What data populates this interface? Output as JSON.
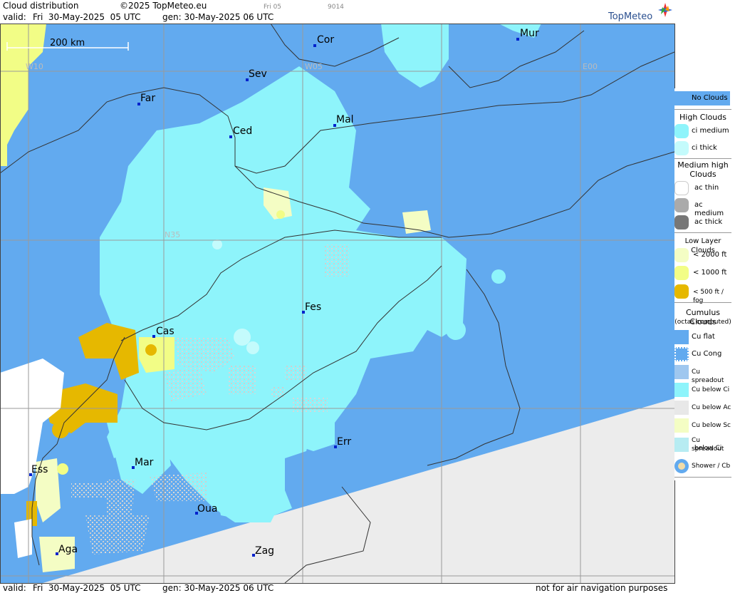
{
  "header": {
    "title": "Cloud distribution",
    "copyright": "©2025 TopMeteo.eu",
    "valid_label": "valid:",
    "valid_value": "Fri  30-May-2025  05 UTC",
    "gen_value": "gen: 30-May-2025 06 UTC",
    "small_code_1": "Fri 05",
    "small_code_2": "9014",
    "logo_text": "TopMeteo"
  },
  "map": {
    "scale_label": "200 km",
    "grid_labels": [
      "W10",
      "W05",
      "E00",
      "N35"
    ],
    "cities": [
      "Cor",
      "Mur",
      "Sev",
      "Far",
      "Mal",
      "Ced",
      "Fes",
      "Cas",
      "Err",
      "Mar",
      "Ess",
      "Oua",
      "Aga",
      "Zag"
    ]
  },
  "legend": {
    "no_clouds": "No Clouds",
    "high_clouds": "High Clouds",
    "ci_medium": "ci medium",
    "ci_thick": "ci thick",
    "medium_high_clouds_1": "Medium high",
    "medium_high_clouds_2": "Clouds",
    "ac_thin": "ac thin",
    "ac_medium": "ac medium",
    "ac_thick": "ac thick",
    "low_layer_clouds": "Low Layer Clouds",
    "lt2000": "< 2000 ft",
    "lt1000": "< 1000 ft",
    "lt500": "< 500 ft / fog",
    "cumulus_clouds": "Cumulus Clouds",
    "octas_computed": "(octas computed)",
    "cu_flat": "Cu flat",
    "cu_cong": "Cu Cong",
    "cu_spreadout": "Cu spreadout",
    "cu_below_ci": "Cu below Ci",
    "cu_below_ac": "Cu below Ac",
    "cu_below_sc": "Cu below Sc",
    "cu_spreadout_below_ci_1": "Cu spreadout",
    "cu_spreadout_below_ci_2": "below Ci",
    "shower_cb": "Shower / Cb"
  },
  "footer": {
    "valid_label": "valid:",
    "valid_value": "Fri  30-May-2025  05 UTC",
    "gen_value": "gen: 30-May-2025 06 UTC",
    "disclaimer": "not for air navigation purposes"
  },
  "colors": {
    "no_clouds": "#62aaef",
    "ci_medium": "#8ef4fb",
    "ci_thick": "#c4fbfc",
    "low_2000": "#f4fdc4",
    "low_1000": "#f2fd86",
    "fog": "#e6b800",
    "outside": "#ececec",
    "cumulus": "#c8c8c8",
    "ac_thin": "#ffffff"
  }
}
